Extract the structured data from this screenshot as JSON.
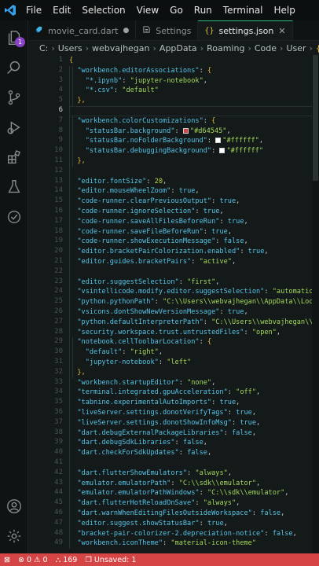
{
  "menu": [
    "File",
    "Edit",
    "Selection",
    "View",
    "Go",
    "Run",
    "Terminal",
    "Help"
  ],
  "activity": {
    "explorer_badge": "1"
  },
  "tabs": [
    {
      "label": "movie_card.dart",
      "icon": "dart-icon",
      "close": "●"
    },
    {
      "label": "Settings",
      "icon": "settings-file-icon",
      "close": ""
    },
    {
      "label": "settings.json",
      "icon": "json-braces-icon",
      "close": "✕"
    }
  ],
  "breadcrumb": [
    "C:",
    "Users",
    "webvajhegan",
    "AppData",
    "Roaming",
    "Code",
    "User",
    "settings.json"
  ],
  "editor": {
    "current_line": "6",
    "lines": [
      {
        "n": "1",
        "t": [
          [
            "b",
            "{"
          ]
        ]
      },
      {
        "n": "2",
        "t": [
          [
            "k",
            "  \"workbench.editorAssociations\""
          ],
          [
            "p",
            ": "
          ],
          [
            "b",
            "{"
          ]
        ]
      },
      {
        "n": "3",
        "t": [
          [
            "k",
            "    \"*.ipynb\""
          ],
          [
            "p",
            ": "
          ],
          [
            "s",
            "\"jupyter-notebook\""
          ],
          [
            "p",
            ","
          ]
        ]
      },
      {
        "n": "4",
        "t": [
          [
            "k",
            "    \"*.csv\""
          ],
          [
            "p",
            ": "
          ],
          [
            "s",
            "\"default\""
          ]
        ]
      },
      {
        "n": "5",
        "t": [
          [
            "b",
            "  },"
          ]
        ]
      },
      {
        "n": "6",
        "t": [
          [
            "p",
            ""
          ]
        ]
      },
      {
        "n": "7",
        "t": [
          [
            "k",
            "  \"workbench.colorCustomizations\""
          ],
          [
            "p",
            ": "
          ],
          [
            "b",
            "{"
          ]
        ]
      },
      {
        "n": "8",
        "t": [
          [
            "k",
            "    \"statusBar.background\""
          ],
          [
            "p",
            ": "
          ],
          [
            "sw1",
            ""
          ],
          [
            "s",
            "\"#d64545\""
          ],
          [
            "p",
            ","
          ]
        ]
      },
      {
        "n": "9",
        "t": [
          [
            "k",
            "    \"statusBar.noFolderBackground\""
          ],
          [
            "p",
            ": "
          ],
          [
            "sw2",
            ""
          ],
          [
            "s",
            "\"#ffffff\""
          ],
          [
            "p",
            ","
          ]
        ]
      },
      {
        "n": "10",
        "t": [
          [
            "k",
            "    \"statusBar.debuggingBackground\""
          ],
          [
            "p",
            ": "
          ],
          [
            "sw2",
            ""
          ],
          [
            "s",
            "\"#ffffff\""
          ]
        ]
      },
      {
        "n": "11",
        "t": [
          [
            "b",
            "  },"
          ]
        ]
      },
      {
        "n": "12",
        "t": [
          [
            "p",
            ""
          ]
        ]
      },
      {
        "n": "13",
        "t": [
          [
            "k",
            "  \"editor.fontSize\""
          ],
          [
            "p",
            ": "
          ],
          [
            "n",
            "20"
          ],
          [
            "p",
            ","
          ]
        ]
      },
      {
        "n": "14",
        "t": [
          [
            "k",
            "  \"editor.mouseWheelZoom\""
          ],
          [
            "p",
            ": "
          ],
          [
            "kw",
            "true"
          ],
          [
            "p",
            ","
          ]
        ]
      },
      {
        "n": "15",
        "t": [
          [
            "k",
            "  \"code-runner.clearPreviousOutput\""
          ],
          [
            "p",
            ": "
          ],
          [
            "kw",
            "true"
          ],
          [
            "p",
            ","
          ]
        ]
      },
      {
        "n": "16",
        "t": [
          [
            "k",
            "  \"code-runner.ignoreSelection\""
          ],
          [
            "p",
            ": "
          ],
          [
            "kw",
            "true"
          ],
          [
            "p",
            ","
          ]
        ]
      },
      {
        "n": "17",
        "t": [
          [
            "k",
            "  \"code-runner.saveAllFilesBeforeRun\""
          ],
          [
            "p",
            ": "
          ],
          [
            "kw",
            "true"
          ],
          [
            "p",
            ","
          ]
        ]
      },
      {
        "n": "18",
        "t": [
          [
            "k",
            "  \"code-runner.saveFileBeforeRun\""
          ],
          [
            "p",
            ": "
          ],
          [
            "kw",
            "true"
          ],
          [
            "p",
            ","
          ]
        ]
      },
      {
        "n": "19",
        "t": [
          [
            "k",
            "  \"code-runner.showExecutionMessage\""
          ],
          [
            "p",
            ": "
          ],
          [
            "kw",
            "false"
          ],
          [
            "p",
            ","
          ]
        ]
      },
      {
        "n": "20",
        "t": [
          [
            "k",
            "  \"editor.bracketPairColorization.enabled\""
          ],
          [
            "p",
            ": "
          ],
          [
            "kw",
            "true"
          ],
          [
            "p",
            ","
          ]
        ]
      },
      {
        "n": "21",
        "t": [
          [
            "k",
            "  \"editor.guides.bracketPairs\""
          ],
          [
            "p",
            ": "
          ],
          [
            "s",
            "\"active\""
          ],
          [
            "p",
            ","
          ]
        ]
      },
      {
        "n": "22",
        "t": [
          [
            "p",
            ""
          ]
        ]
      },
      {
        "n": "23",
        "t": [
          [
            "k",
            "  \"editor.suggestSelection\""
          ],
          [
            "p",
            ": "
          ],
          [
            "s",
            "\"first\""
          ],
          [
            "p",
            ","
          ]
        ]
      },
      {
        "n": "24",
        "t": [
          [
            "k",
            "  \"vsintellicode.modify.editor.suggestSelection\""
          ],
          [
            "p",
            ": "
          ],
          [
            "s",
            "\"automaticallyOverrodeDefaultValue\""
          ]
        ]
      },
      {
        "n": "25",
        "t": [
          [
            "k",
            "  \"python.pythonPath\""
          ],
          [
            "p",
            ": "
          ],
          [
            "s",
            "\"C:\\\\Users\\\\webvajhegan\\\\AppData\\\\Local\""
          ]
        ]
      },
      {
        "n": "26",
        "t": [
          [
            "k",
            "  \"vsicons.dontShowNewVersionMessage\""
          ],
          [
            "p",
            ": "
          ],
          [
            "kw",
            "true"
          ],
          [
            "p",
            ","
          ]
        ]
      },
      {
        "n": "27",
        "t": [
          [
            "k",
            "  \"python.defaultInterpreterPath\""
          ],
          [
            "p",
            ": "
          ],
          [
            "s",
            "\"C:\\\\Users\\\\webvajhegan\\\\\""
          ]
        ]
      },
      {
        "n": "28",
        "t": [
          [
            "k",
            "  \"security.workspace.trust.untrustedFiles\""
          ],
          [
            "p",
            ": "
          ],
          [
            "s",
            "\"open\""
          ],
          [
            "p",
            ","
          ]
        ]
      },
      {
        "n": "29",
        "t": [
          [
            "k",
            "  \"notebook.cellToolbarLocation\""
          ],
          [
            "p",
            ": "
          ],
          [
            "b",
            "{"
          ]
        ]
      },
      {
        "n": "30",
        "t": [
          [
            "k",
            "    \"default\""
          ],
          [
            "p",
            ": "
          ],
          [
            "s",
            "\"right\""
          ],
          [
            "p",
            ","
          ]
        ]
      },
      {
        "n": "31",
        "t": [
          [
            "k",
            "    \"jupyter-notebook\""
          ],
          [
            "p",
            ": "
          ],
          [
            "s",
            "\"left\""
          ]
        ]
      },
      {
        "n": "32",
        "t": [
          [
            "b",
            "  },"
          ]
        ]
      },
      {
        "n": "33",
        "t": [
          [
            "k",
            "  \"workbench.startupEditor\""
          ],
          [
            "p",
            ": "
          ],
          [
            "s",
            "\"none\""
          ],
          [
            "p",
            ","
          ]
        ]
      },
      {
        "n": "34",
        "t": [
          [
            "k",
            "  \"terminal.integrated.gpuAcceleration\""
          ],
          [
            "p",
            ": "
          ],
          [
            "s",
            "\"off\""
          ],
          [
            "p",
            ","
          ]
        ]
      },
      {
        "n": "35",
        "t": [
          [
            "k",
            "  \"tabnine.experimentalAutoImports\""
          ],
          [
            "p",
            ": "
          ],
          [
            "kw",
            "true"
          ],
          [
            "p",
            ","
          ]
        ]
      },
      {
        "n": "36",
        "t": [
          [
            "k",
            "  \"liveServer.settings.donotVerifyTags\""
          ],
          [
            "p",
            ": "
          ],
          [
            "kw",
            "true"
          ],
          [
            "p",
            ","
          ]
        ]
      },
      {
        "n": "37",
        "t": [
          [
            "k",
            "  \"liveServer.settings.donotShowInfoMsg\""
          ],
          [
            "p",
            ": "
          ],
          [
            "kw",
            "true"
          ],
          [
            "p",
            ","
          ]
        ]
      },
      {
        "n": "38",
        "t": [
          [
            "k",
            "  \"dart.debugExternalPackageLibraries\""
          ],
          [
            "p",
            ": "
          ],
          [
            "kw",
            "false"
          ],
          [
            "p",
            ","
          ]
        ]
      },
      {
        "n": "39",
        "t": [
          [
            "k",
            "  \"dart.debugSdkLibraries\""
          ],
          [
            "p",
            ": "
          ],
          [
            "kw",
            "false"
          ],
          [
            "p",
            ","
          ]
        ]
      },
      {
        "n": "40",
        "t": [
          [
            "k",
            "  \"dart.checkForSdkUpdates\""
          ],
          [
            "p",
            ": "
          ],
          [
            "kw",
            "false"
          ],
          [
            "p",
            ","
          ]
        ]
      },
      {
        "n": "41",
        "t": [
          [
            "p",
            ""
          ]
        ]
      },
      {
        "n": "42",
        "t": [
          [
            "k",
            "  \"dart.flutterShowEmulators\""
          ],
          [
            "p",
            ": "
          ],
          [
            "s",
            "\"always\""
          ],
          [
            "p",
            ","
          ]
        ]
      },
      {
        "n": "43",
        "t": [
          [
            "k",
            "  \"emulator.emulatorPath\""
          ],
          [
            "p",
            ": "
          ],
          [
            "s",
            "\"C:\\\\sdk\\\\emulator\""
          ],
          [
            "p",
            ","
          ]
        ]
      },
      {
        "n": "44",
        "t": [
          [
            "k",
            "  \"emulator.emulatorPathWindows\""
          ],
          [
            "p",
            ": "
          ],
          [
            "s",
            "\"C:\\\\sdk\\\\emulator\""
          ],
          [
            "p",
            ","
          ]
        ]
      },
      {
        "n": "45",
        "t": [
          [
            "k",
            "  \"dart.flutterHotReloadOnSave\""
          ],
          [
            "p",
            ": "
          ],
          [
            "s",
            "\"always\""
          ],
          [
            "p",
            ","
          ]
        ]
      },
      {
        "n": "46",
        "t": [
          [
            "k",
            "  \"dart.warnWhenEditingFilesOutsideWorkspace\""
          ],
          [
            "p",
            ": "
          ],
          [
            "kw",
            "false"
          ],
          [
            "p",
            ","
          ]
        ]
      },
      {
        "n": "47",
        "t": [
          [
            "k",
            "  \"editor.suggest.showStatusBar\""
          ],
          [
            "p",
            ": "
          ],
          [
            "kw",
            "true"
          ],
          [
            "p",
            ","
          ]
        ]
      },
      {
        "n": "48",
        "t": [
          [
            "k",
            "  \"bracket-pair-colorizer-2.depreciation-notice\""
          ],
          [
            "p",
            ": "
          ],
          [
            "kw",
            "false"
          ],
          [
            "p",
            ","
          ]
        ]
      },
      {
        "n": "49",
        "t": [
          [
            "k",
            "  \"workbench.iconTheme\""
          ],
          [
            "p",
            ": "
          ],
          [
            "s",
            "\"material-icon-theme\""
          ]
        ]
      }
    ]
  },
  "status": {
    "remote": "⊠",
    "errors": "0",
    "warnings": "0",
    "ports": "169",
    "unsaved": "Unsaved: 1"
  },
  "colors": {
    "statusbar": "#d64545",
    "accent": "#2bb67a",
    "badge": "#8a43c6"
  }
}
